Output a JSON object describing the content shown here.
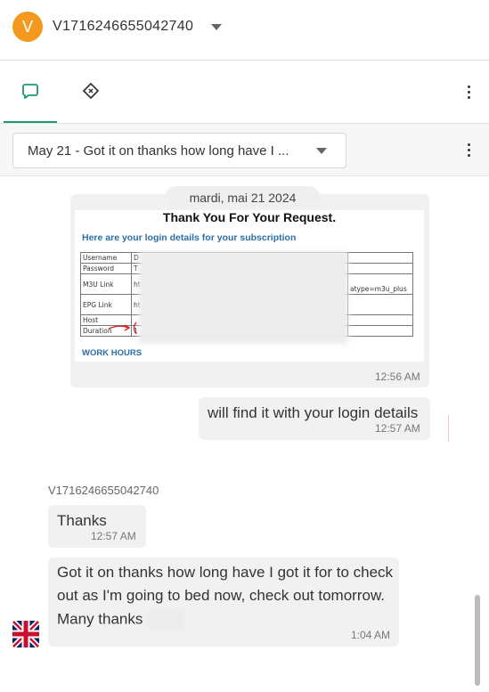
{
  "header": {
    "avatar_letter": "V",
    "avatar_color": "#f39a1e",
    "contact_name": "V1716246655042740",
    "caret_icon": "caret-down-icon"
  },
  "tabs": [
    {
      "icon": "chat-bubble-icon",
      "active": true
    },
    {
      "icon": "diamond-tag-icon",
      "active": false
    }
  ],
  "conversation": {
    "selected": "May 21 - Got it on thanks how long have I ...",
    "menu_icon": "more-vertical-icon"
  },
  "chat": {
    "date": "mardi, mai 21 2024",
    "image_message": {
      "title": "Thank You For Your Request.",
      "subtitle": "Here are your login details for your subscription",
      "rows": [
        {
          "label": "Username",
          "value": "D",
          "extra": ""
        },
        {
          "label": "Password",
          "value": "T",
          "extra": ""
        },
        {
          "label": "M3U Link",
          "value": "ht",
          "extra": "atype=m3u_plus"
        },
        {
          "label": "EPG Link",
          "value": "ht",
          "extra": ""
        },
        {
          "label": "Host",
          "value": "",
          "extra": ""
        },
        {
          "label": "Duration",
          "value": "1",
          "extra": ""
        }
      ],
      "footer": "WORK HOURS",
      "time": "12:56 AM"
    },
    "outgoing": {
      "text": "will find it with your login details",
      "time": "12:57 AM"
    },
    "agent_name": "V1716246655042740",
    "incoming_1": {
      "text": "Thanks",
      "time": "12:57 AM"
    },
    "incoming_2": {
      "line1": "Got it on thanks how long have I got it for to check",
      "line2": "out as I'm going to bed now, check out tomorrow.",
      "line3": "Many thanks",
      "time": "1:04 AM"
    },
    "flag_icon": "uk-flag-icon"
  },
  "colors": {
    "accent": "#1a9a6b",
    "bubble": "#f1f1f1"
  }
}
